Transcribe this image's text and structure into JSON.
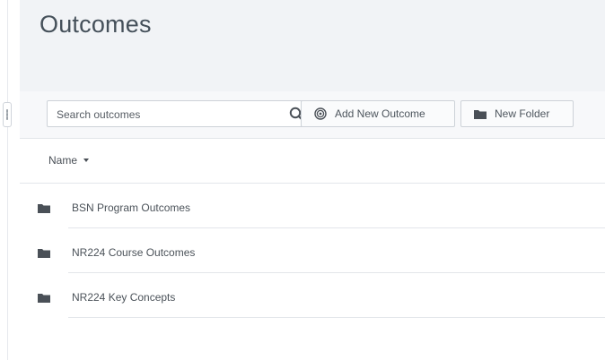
{
  "header": {
    "title": "Outcomes"
  },
  "toolbar": {
    "search_placeholder": "Search outcomes",
    "add_label": "Add New Outcome",
    "folder_label": "New Folder"
  },
  "table": {
    "sort_label": "Name"
  },
  "items": [
    {
      "label": "BSN Program Outcomes",
      "icon": "folder-icon"
    },
    {
      "label": "NR224 Course Outcomes",
      "icon": "folder-icon"
    },
    {
      "label": "NR224 Key Concepts",
      "icon": "folder-icon"
    }
  ]
}
